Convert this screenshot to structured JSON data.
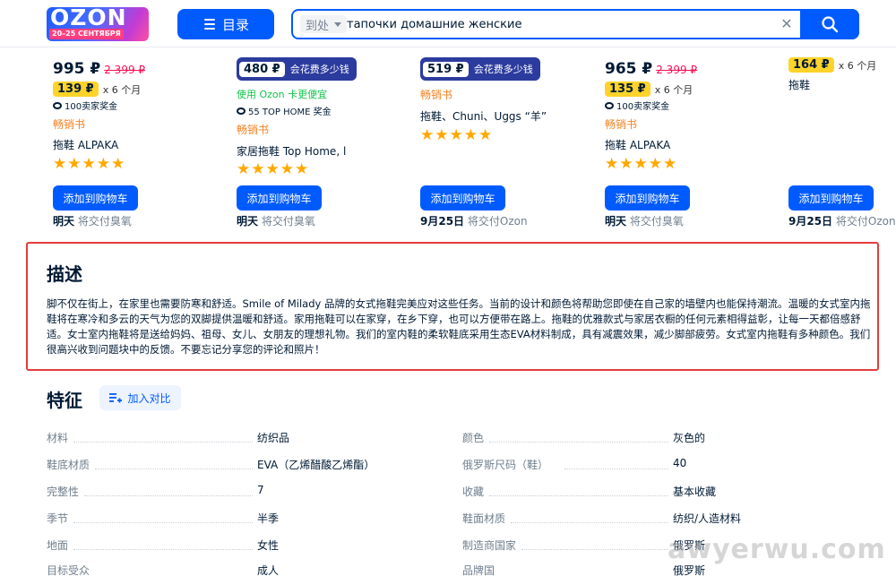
{
  "header": {
    "logo_text": "OZON",
    "logo_date": "20–25 СЕНТЯБРЯ",
    "catalog_label": "目录",
    "search_scope": "到处",
    "search_value": "тапочки домашние женские"
  },
  "products": [
    {
      "price": "995 ₽",
      "old_price": "2 399 ₽",
      "installment_price": "139 ₽",
      "installment_text": "x 6 个月",
      "bonus": "100卖家奖金",
      "bestseller": "畅销书",
      "name": "拖鞋 ALPAKA",
      "cart_label": "添加到购物车",
      "delivery_day": "明天",
      "delivery_text": "将交付臭氧"
    },
    {
      "card_price": "480 ₽",
      "card_text": "会花费多少钱",
      "ozon_card_text": "使用 Ozon 卡更便宜",
      "bonus": "55 TOP HOME 奖金",
      "bestseller": "畅销书",
      "name": "家居拖鞋 Top Home, l",
      "cart_label": "添加到购物车",
      "delivery_day": "明天",
      "delivery_text": "将交付臭氧"
    },
    {
      "card_price": "519 ₽",
      "card_text": "会花费多少钱",
      "bestseller": "畅销书",
      "name": "拖鞋、Chuni、Uggs “羊”",
      "cart_label": "添加到购物车",
      "delivery_day": "9月25日",
      "delivery_text": "将交付Ozon"
    },
    {
      "price": "965 ₽",
      "old_price": "2 399 ₽",
      "installment_price": "135 ₽",
      "installment_text": "x 6 个月",
      "bonus": "100卖家奖金",
      "bestseller": "畅销书",
      "name": "拖鞋 ALPAKA",
      "cart_label": "添加到购物车",
      "delivery_day": "明天",
      "delivery_text": "将交付臭氧"
    },
    {
      "installment_price": "164 ₽",
      "installment_text": "x 6 个月",
      "name": "拖鞋",
      "cart_label": "添加到购物车",
      "delivery_day": "9月25日",
      "delivery_text": "将交付Ozon"
    }
  ],
  "description": {
    "title": "描述",
    "text": "脚不仅在街上，在家里也需要防寒和舒适。Smile of Milady 品牌的女式拖鞋完美应对这些任务。当前的设计和颜色将帮助您即使在自己家的墙壁内也能保持潮流。温暖的女式室内拖鞋将在寒冷和多云的天气为您的双脚提供温暖和舒适。家用拖鞋可以在家穿，在乡下穿，也可以方便带在路上。拖鞋的优雅款式与家居衣橱的任何元素相得益彰，让每一天都倍感舒适。女士室内拖鞋将是送给妈妈、祖母、女儿、女朋友的理想礼物。我们的室内鞋的柔软鞋底采用生态EVA材料制成，具有减震效果，减少脚部疲劳。女式室内拖鞋有多种颜色。我们很高兴收到问题块中的反馈。不要忘记分享您的评论和照片！"
  },
  "specs": {
    "title": "特征",
    "compare_label": "加入对比",
    "left": [
      {
        "label": "材料",
        "value": "纺织品"
      },
      {
        "label": "鞋底材质",
        "value": "EVA（乙烯醋酸乙烯酯）"
      },
      {
        "label": "完整性",
        "value": "7"
      },
      {
        "label": "季节",
        "value": "半季"
      },
      {
        "label": "地面",
        "value": "女性"
      },
      {
        "label": "目标受众",
        "value": "成人"
      }
    ],
    "right": [
      {
        "label": "颜色",
        "value": "灰色的"
      },
      {
        "label": "俄罗斯尺码（鞋）",
        "value": "40"
      },
      {
        "label": "收藏",
        "value": "基本收藏"
      },
      {
        "label": "鞋面材质",
        "value": "纺织/人造材料"
      },
      {
        "label": "制造商国家",
        "value": "俄罗斯"
      },
      {
        "label": "品牌国",
        "value": "俄罗斯"
      }
    ]
  },
  "watermark": "awyerwu.com",
  "colors": {
    "accent": "#005bff",
    "price_old": "#f91155",
    "bestseller": "#f58220",
    "highlight_border": "#e43c3c",
    "installment_badge": "#ffd329"
  }
}
